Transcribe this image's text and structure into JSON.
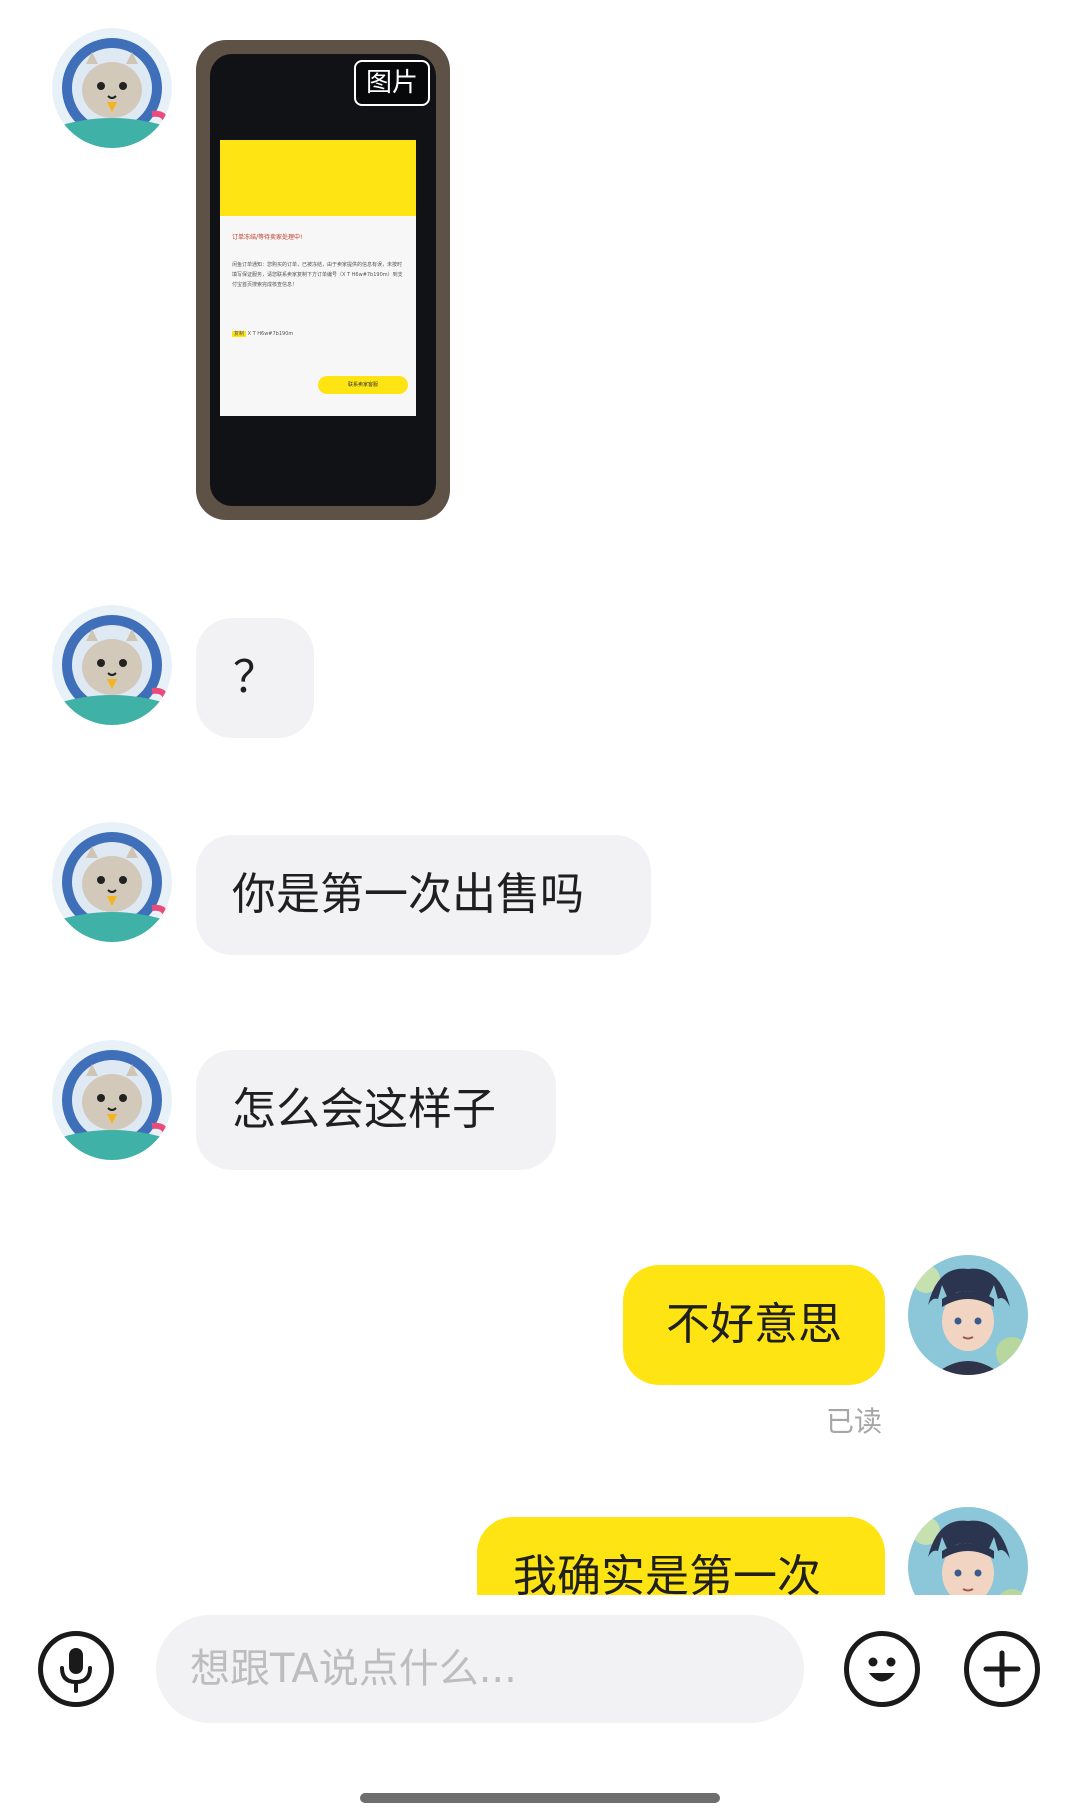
{
  "messages": [
    {
      "type": "image",
      "tag": "图片",
      "content": {
        "title": "订单冻结/等待卖家处理中!",
        "body": "闲鱼订单通知：您购买的订单，已被冻结，由于卖家提供的信息有误，未按时填写保证服务，请您联系卖家复制下方订单编号（X T H6w#7b190m）到支付宝首页搜索完成核查信息！",
        "copy_label": "复制",
        "copy_text": "X T H6w#7b190m",
        "button": "联系卖家客服"
      }
    },
    {
      "type": "text",
      "sender": "them",
      "text": "？"
    },
    {
      "type": "text",
      "sender": "them",
      "text": "你是第一次出售吗"
    },
    {
      "type": "text",
      "sender": "them",
      "text": "怎么会这样子"
    },
    {
      "type": "text",
      "sender": "me",
      "text": "不好意思",
      "status": "已读"
    },
    {
      "type": "text",
      "sender": "me",
      "text": "我确实是第一次"
    }
  ],
  "input": {
    "placeholder": "想跟TA说点什么..."
  },
  "icons": {
    "voice": "microphone-icon",
    "emoji": "smile-icon",
    "more": "plus-icon"
  },
  "colors": {
    "my_bubble": "#ffe414",
    "their_bubble": "#f2f2f4"
  }
}
